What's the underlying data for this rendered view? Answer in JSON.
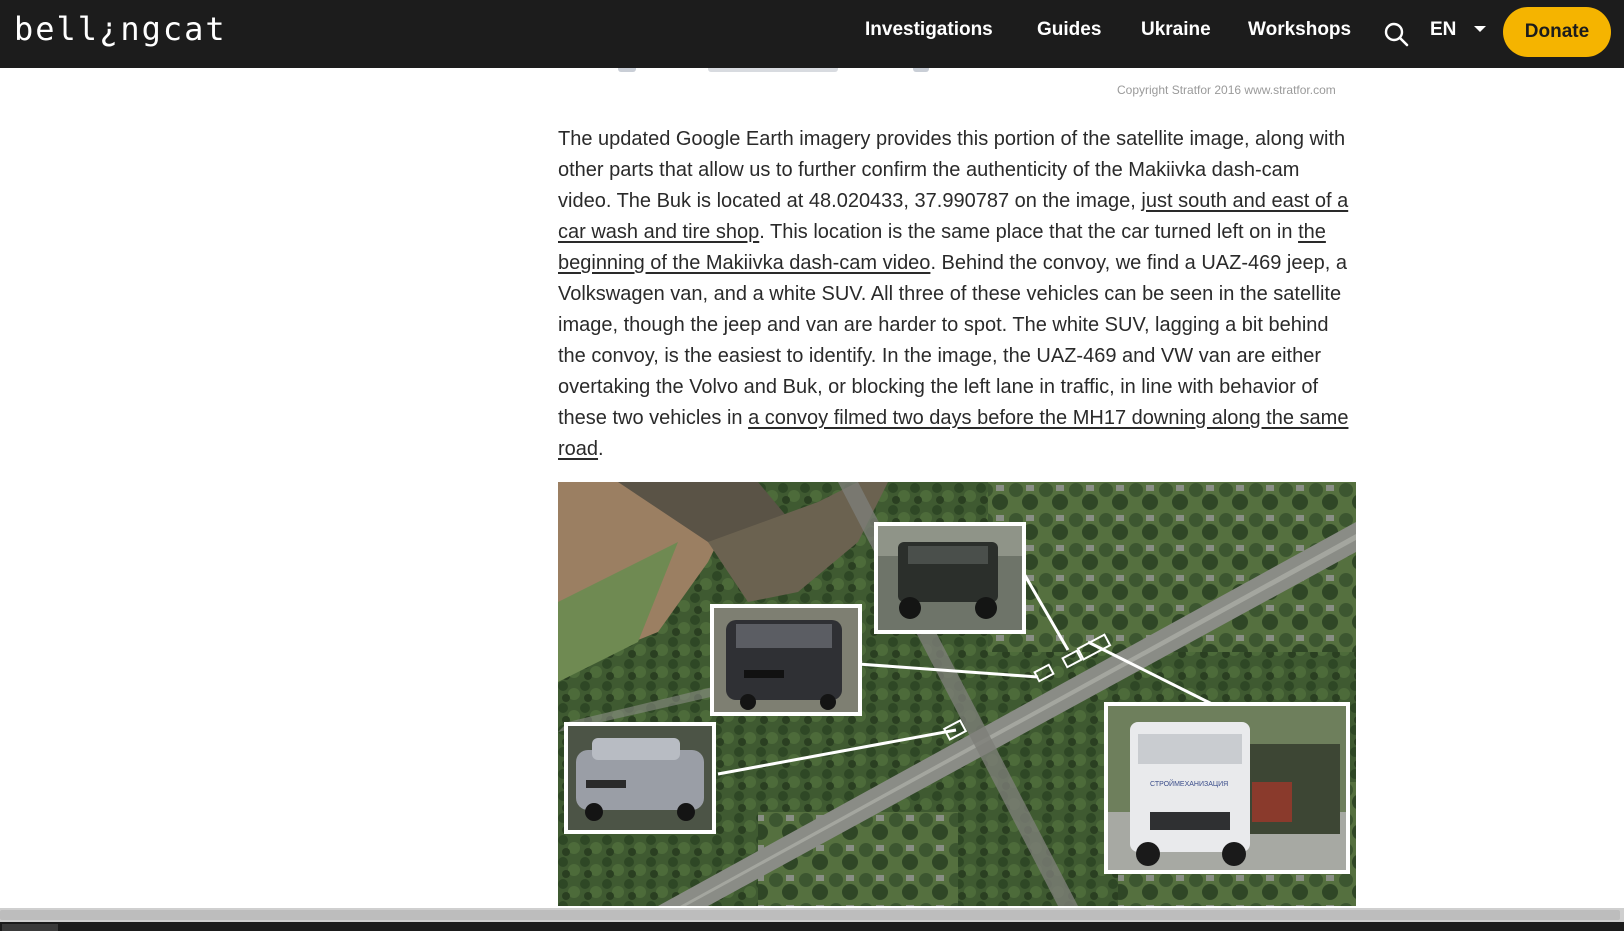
{
  "brand": {
    "logo_text": "bell¿ngcat"
  },
  "nav": {
    "items": [
      {
        "label": "Investigations"
      },
      {
        "label": "Guides"
      },
      {
        "label": "Ukraine"
      },
      {
        "label": "Workshops"
      }
    ],
    "search_icon": "search-icon",
    "language": "EN",
    "donate_label": "Donate"
  },
  "figure_top": {
    "copyright": "Copyright Stratfor 2016   www.stratfor.com"
  },
  "article": {
    "t1": "The updated Google Earth imagery provides this portion of the satellite image, along with other parts that allow us to further confirm the authenticity of the Makiivka dash-cam video. The Buk is located at 48.020433, 37.990787 on the image, ",
    "link1": "just south and east of a car wash and tire shop",
    "t2": ". This location is the same place that the car turned left on in ",
    "link2": "the beginning of the Makiivka dash-cam video",
    "t3": ". Behind the convoy, we find a UAZ-469 jeep, a Volkswagen van, and a white SUV. All three of these vehicles can be seen in the satellite image, though the jeep and van are harder to spot. The white SUV, lagging a bit behind the convoy, is the easiest to identify. In the image, the UAZ-469 and VW van are either overtaking the Volvo and Buk, or blocking the left lane in traffic, in line with behavior of these two vehicles in ",
    "link3": "a convoy filmed two days before the MH17 downing along the same road",
    "t4": "."
  },
  "figure": {
    "truck_label": "СТРОЙМЕХАНИЗАЦИЯ"
  },
  "colors": {
    "header_bg": "#1c1c1c",
    "donate_bg": "#f5b400",
    "text": "#2a2a2a"
  }
}
